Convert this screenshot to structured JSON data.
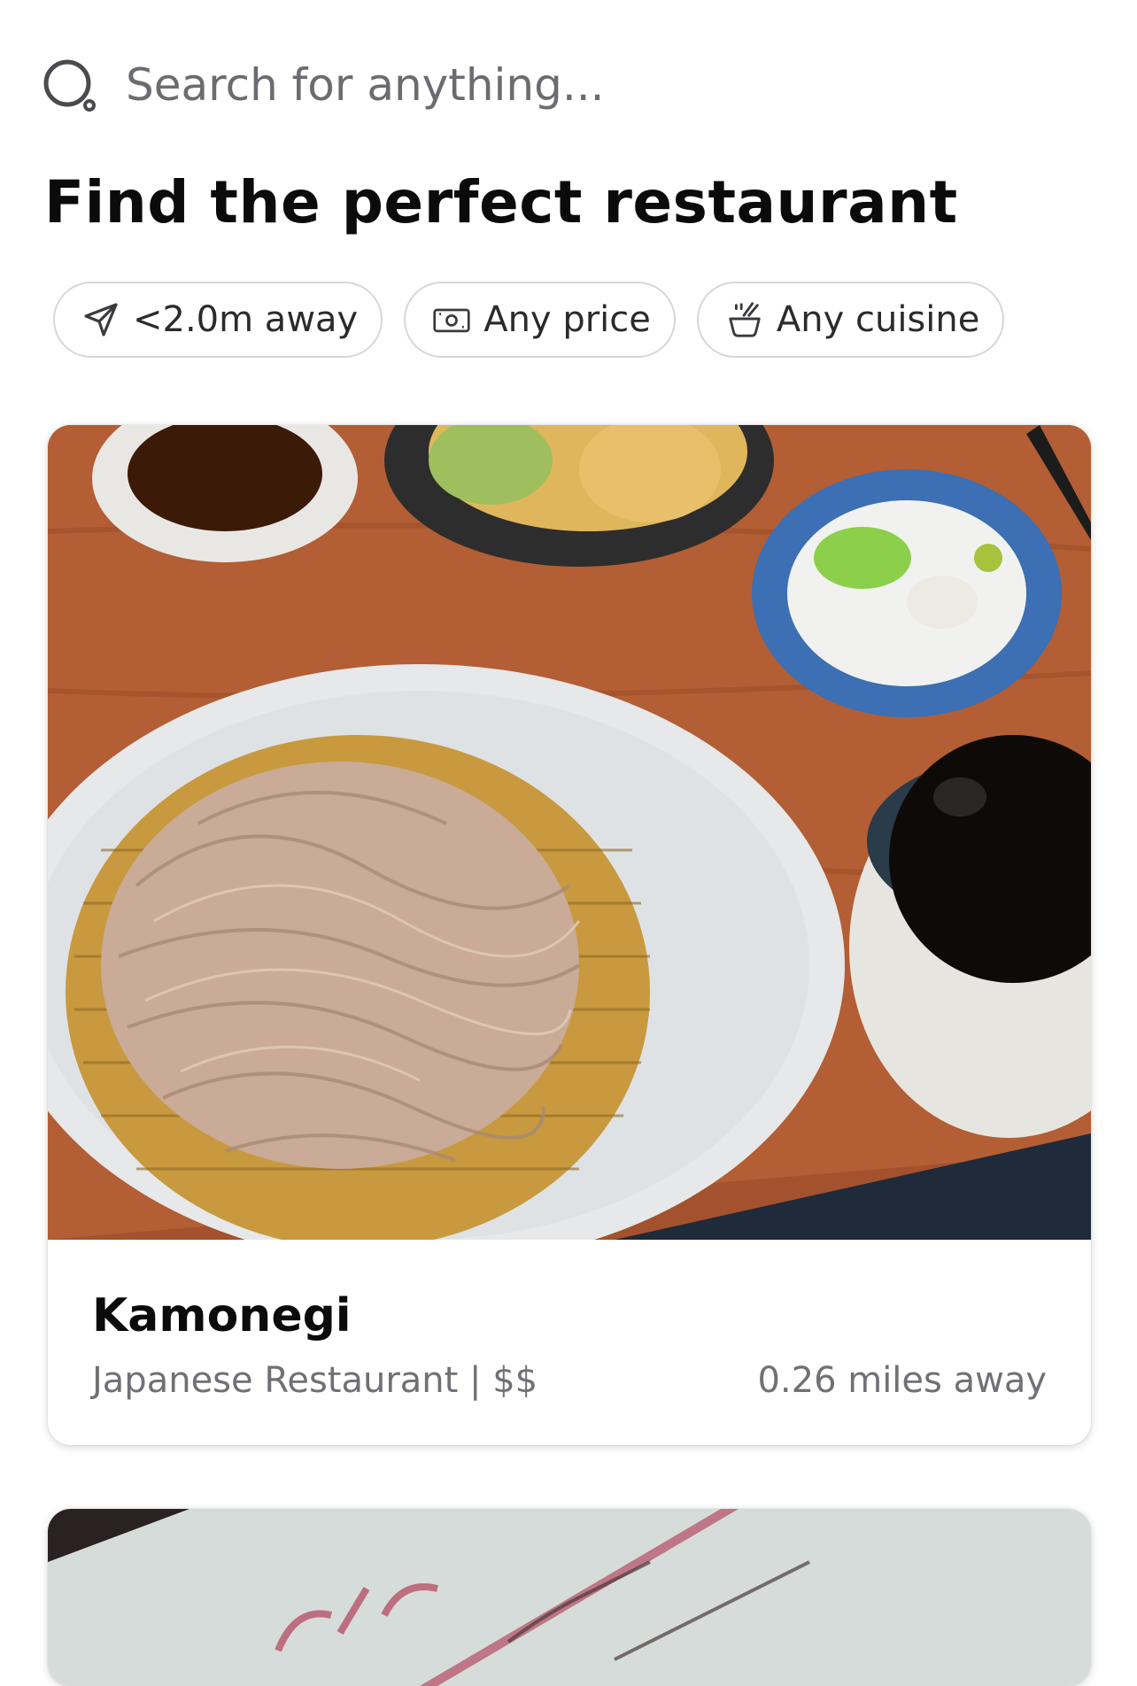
{
  "search": {
    "placeholder": "Search for anything...",
    "icon": "search-icon"
  },
  "page_title": "Find the perfect restaurant",
  "filters": [
    {
      "label": "<2.0m away",
      "icon": "location-arrow-icon"
    },
    {
      "label": "Any price",
      "icon": "cash-icon"
    },
    {
      "label": "Any cuisine",
      "icon": "bowl-icon"
    }
  ],
  "restaurants": [
    {
      "name": "Kamonegi",
      "meta": "Japanese Restaurant | $$",
      "distance": "0.26 miles away",
      "photo": "soba-noodles-photo"
    },
    {
      "photo": "menu-photo"
    }
  ],
  "colors": {
    "text_primary": "#0b0b0b",
    "text_secondary": "#707075",
    "chip_border": "#d7d7db",
    "card_shadow": "#e0e0e0"
  }
}
